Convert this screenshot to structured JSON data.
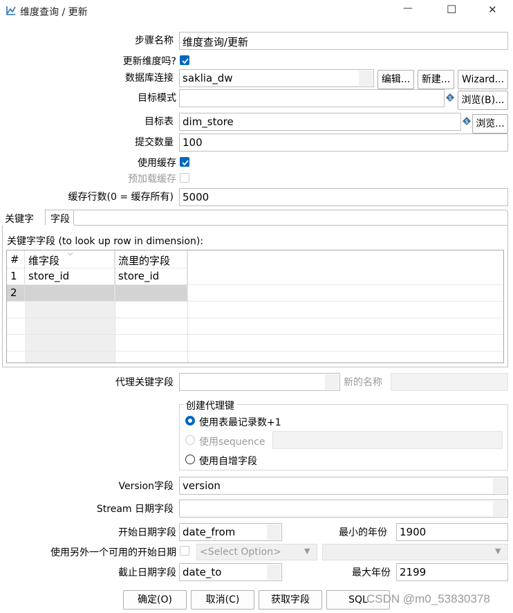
{
  "window": {
    "title": "维度查询 / 更新",
    "minimize": "—",
    "maximize": "☐",
    "close": "✕"
  },
  "form": {
    "step_name_label": "步骤名称",
    "step_name_value": "维度查询/更新",
    "update_dim_label": "更新维度吗?",
    "update_dim_checked": true,
    "db_conn_label": "数据库连接",
    "db_conn_value": "saklia_dw",
    "edit_button": "编辑...",
    "new_button": "新建...",
    "wizard_button": "Wizard...",
    "target_schema_label": "目标模式",
    "target_schema_value": "",
    "browse_schema_button": "浏览(B)...",
    "target_table_label": "目标表",
    "target_table_value": "dim_store",
    "browse_table_button": "浏览...",
    "commit_size_label": "提交数量",
    "commit_size_value": "100",
    "use_cache_label": "使用缓存",
    "use_cache_checked": true,
    "preload_cache_label": "预加载缓存",
    "preload_cache_checked": false,
    "cache_rows_label": "缓存行数(0 = 缓存所有)",
    "cache_rows_value": "5000"
  },
  "tabs": {
    "keys_tab": "关键字",
    "fields_tab": "字段",
    "key_fields_caption": "关键字字段 (to look up row in dimension):",
    "columns": [
      "#",
      "维字段",
      "流里的字段"
    ],
    "rows": [
      {
        "num": "1",
        "dim_field": "store_id",
        "stream_field": "store_id"
      },
      {
        "num": "2",
        "dim_field": "",
        "stream_field": ""
      }
    ]
  },
  "surrogate": {
    "tech_key_label": "代理关键字段",
    "tech_key_value": "",
    "new_name_label": "新的名称",
    "new_name_value": "",
    "group_title": "创建代理键",
    "opt_table_max": "使用表最记录数+1",
    "opt_sequence": "使用sequence",
    "opt_autoinc": "使用自增字段"
  },
  "versioning": {
    "version_label": "Version字段",
    "version_value": "version",
    "stream_date_label": "Stream 日期字段",
    "stream_date_value": "",
    "start_date_label": "开始日期字段",
    "start_date_value": "date_from",
    "min_year_label": "最小的年份",
    "min_year_value": "1900",
    "alt_start_label": "使用另外一个可用的开始日期",
    "alt_start_select": "<Select Option>",
    "end_date_label": "截止日期字段",
    "end_date_value": "date_to",
    "max_year_label": "最大年份",
    "max_year_value": "2199"
  },
  "buttons": {
    "ok": "确定(O)",
    "cancel": "取消(C)",
    "get_fields": "获取字段",
    "sql": "SQL"
  },
  "watermark": "CSDN @m0_53830378",
  "colors": {
    "accent": "#0067c0",
    "selected_row": "#d3d3d3"
  }
}
